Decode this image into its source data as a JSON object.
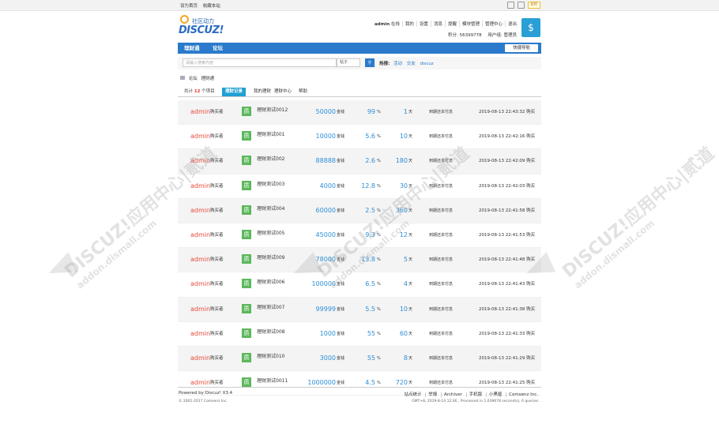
{
  "topbar": {
    "set_home": "设为首页",
    "bookmark": "收藏本站",
    "diy": "DIY"
  },
  "logo": {
    "tagline": "社区动力",
    "name": "DISCUZ!"
  },
  "user_menu": {
    "username": "admin",
    "online": "在线",
    "items": [
      "我的",
      "设置",
      "消息",
      "提醒",
      "模块管理",
      "管理中心",
      "退出"
    ],
    "points": "积分: 56399778",
    "group": "用户组: 管理员"
  },
  "nav": {
    "items": [
      "理财通",
      "论坛"
    ],
    "quick_nav": "快捷导航"
  },
  "search": {
    "placeholder": "请输入搜索内容",
    "type": "帖子",
    "hot_label": "热搜:",
    "hot_items": [
      "活动",
      "交友",
      "discuz"
    ]
  },
  "breadcrumb": [
    "论坛",
    "理财通"
  ],
  "tabs": {
    "count_prefix": "共计",
    "count": "12",
    "count_suffix": "个项目",
    "items": [
      "理财记录",
      "我的理财",
      "理财中心",
      "帮助"
    ]
  },
  "rows": [
    {
      "buyer": "admin",
      "role": "购买者",
      "badge": "质",
      "name": "理财测试0012",
      "amount": "50000",
      "unit": "金钱",
      "rate": "99",
      "rate_unit": "%",
      "days": "1",
      "day_unit": "天",
      "status": "到期还本付息",
      "time": "2019-08-13 22:43:32 购买"
    },
    {
      "buyer": "admin",
      "role": "购买者",
      "badge": "质",
      "name": "理财测试001",
      "amount": "10000",
      "unit": "金钱",
      "rate": "5.6",
      "rate_unit": "%",
      "days": "10",
      "day_unit": "天",
      "status": "到期还本付息",
      "time": "2019-08-13 22:42:16 购买"
    },
    {
      "buyer": "admin",
      "role": "购买者",
      "badge": "质",
      "name": "理财测试002",
      "amount": "88888",
      "unit": "金钱",
      "rate": "2.6",
      "rate_unit": "%",
      "days": "180",
      "day_unit": "天",
      "status": "到期还本付息",
      "time": "2019-08-13 22:42:09 购买"
    },
    {
      "buyer": "admin",
      "role": "购买者",
      "badge": "质",
      "name": "理财测试003",
      "amount": "4000",
      "unit": "金钱",
      "rate": "12.8",
      "rate_unit": "%",
      "days": "30",
      "day_unit": "天",
      "status": "到期还本付息",
      "time": "2019-08-13 22:42:03 购买"
    },
    {
      "buyer": "admin",
      "role": "购买者",
      "badge": "质",
      "name": "理财测试004",
      "amount": "60000",
      "unit": "金钱",
      "rate": "2.5",
      "rate_unit": "%",
      "days": "360",
      "day_unit": "天",
      "status": "到期还本付息",
      "time": "2019-08-13 22:41:58 购买"
    },
    {
      "buyer": "admin",
      "role": "购买者",
      "badge": "质",
      "name": "理财测试005",
      "amount": "45000",
      "unit": "金钱",
      "rate": "9.3",
      "rate_unit": "%",
      "days": "12",
      "day_unit": "天",
      "status": "到期还本付息",
      "time": "2019-08-13 22:41:53 购买"
    },
    {
      "buyer": "admin",
      "role": "购买者",
      "badge": "质",
      "name": "理财测试009",
      "amount": "78000",
      "unit": "金钱",
      "rate": "13.8",
      "rate_unit": "%",
      "days": "5",
      "day_unit": "天",
      "status": "到期还本付息",
      "time": "2019-08-13 22:41:48 购买"
    },
    {
      "buyer": "admin",
      "role": "购买者",
      "badge": "质",
      "name": "理财测试006",
      "amount": "100000",
      "unit": "金钱",
      "rate": "6.5",
      "rate_unit": "%",
      "days": "4",
      "day_unit": "天",
      "status": "到期还本付息",
      "time": "2019-08-13 22:41:43 购买"
    },
    {
      "buyer": "admin",
      "role": "购买者",
      "badge": "质",
      "name": "理财测试007",
      "amount": "99999",
      "unit": "金钱",
      "rate": "5.5",
      "rate_unit": "%",
      "days": "10",
      "day_unit": "天",
      "status": "到期还本付息",
      "time": "2019-08-13 22:41:38 购买"
    },
    {
      "buyer": "admin",
      "role": "购买者",
      "badge": "质",
      "name": "理财测试008",
      "amount": "1000",
      "unit": "金钱",
      "rate": "55",
      "rate_unit": "%",
      "days": "60",
      "day_unit": "天",
      "status": "到期还本付息",
      "time": "2019-08-13 22:41:33 购买"
    },
    {
      "buyer": "admin",
      "role": "购买者",
      "badge": "质",
      "name": "理财测试010",
      "amount": "3000",
      "unit": "金钱",
      "rate": "55",
      "rate_unit": "%",
      "days": "8",
      "day_unit": "天",
      "status": "到期还本付息",
      "time": "2019-08-13 22:41:29 购买"
    },
    {
      "buyer": "admin",
      "role": "购买者",
      "badge": "质",
      "name": "理财测试0011",
      "amount": "1000000",
      "unit": "金钱",
      "rate": "4.5",
      "rate_unit": "%",
      "days": "720",
      "day_unit": "天",
      "status": "到期还本付息",
      "time": "2019-08-13 22:41:25 购买"
    }
  ],
  "footer": {
    "powered": "Powered by Discuz! X3.4",
    "copyright": "© 2001-2017 Comsenz Inc.",
    "links": [
      "站点统计",
      "举报",
      "Archiver",
      "手机版",
      "小黑屋",
      "Comsenz Inc."
    ],
    "gmt": "GMT+8, 2019-8-14 12:46 , Processed in 1.039678 second(s), 6 queries ."
  },
  "watermark": {
    "text": "DISCUZ!应用中心|贰道",
    "url": "addon.dismall.com"
  },
  "colors": {
    "nav": "#2b7acb",
    "tab_active": "#1fa0d2",
    "badge": "#5cb85c",
    "buyer": "#e74c3c",
    "value": "#2b8fd8"
  }
}
